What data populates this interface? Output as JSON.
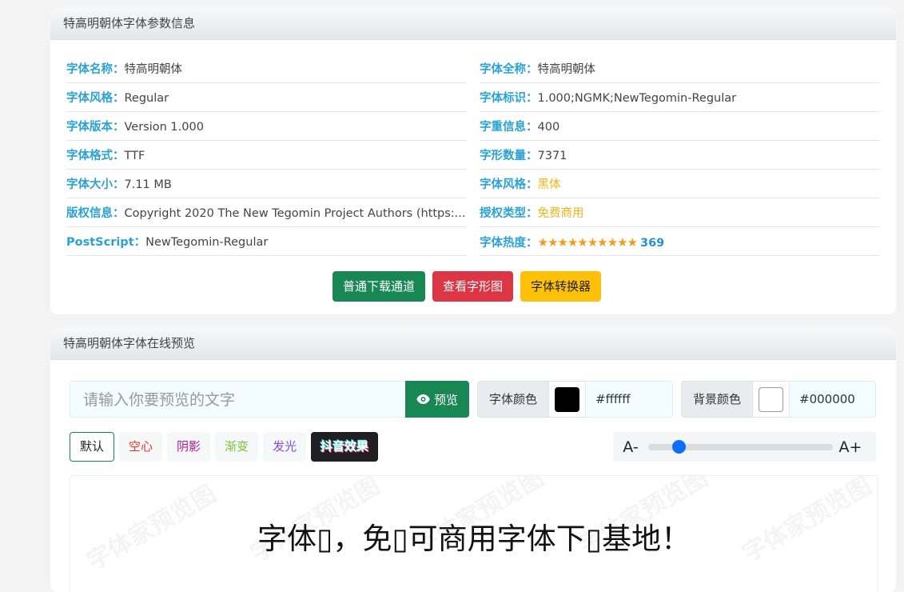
{
  "info_card": {
    "title": "特高明朝体字体参数信息",
    "left": [
      {
        "k": "字体名称：",
        "v": "特高明朝体"
      },
      {
        "k": "字体风格：",
        "v": "Regular"
      },
      {
        "k": "字体版本：",
        "v": "Version 1.000"
      },
      {
        "k": "字体格式：",
        "v": "TTF"
      },
      {
        "k": "字体大小：",
        "v": "7.11 MB"
      },
      {
        "k": "版权信息：",
        "v": "Copyright 2020 The New Tegomin Project Authors (https:..."
      },
      {
        "k": "PostScript：",
        "v": "NewTegomin-Regular"
      }
    ],
    "right": [
      {
        "k": "字体全称：",
        "v": "特高明朝体"
      },
      {
        "k": "字体标识：",
        "v": "1.000;NGMK;NewTegomin-Regular"
      },
      {
        "k": "字重信息：",
        "v": "400"
      },
      {
        "k": "字形数量：",
        "v": "7371"
      },
      {
        "k": "字体风格：",
        "v": "黑体"
      },
      {
        "k": "授权类型：",
        "v": "免费商用"
      }
    ],
    "heat": {
      "k": "字体热度：",
      "stars": "★★★★★★★★★★",
      "value": "369"
    },
    "buttons": {
      "download": "普通下载通道",
      "glyphs": "查看字形图",
      "converter": "字体转换器"
    }
  },
  "preview_card": {
    "title": "特高明朝体字体在线预览",
    "input_placeholder": "请输入你要预览的文字",
    "preview_label": "预览",
    "font_color": {
      "label": "字体颜色",
      "swatch": "#000000",
      "hex": "#ffffff"
    },
    "bg_color": {
      "label": "背景颜色",
      "swatch": "#ffffff",
      "hex": "#000000"
    },
    "effects": {
      "default": "默认",
      "hollow": "空心",
      "shadow": "阴影",
      "gradient": "渐变",
      "glow": "发光",
      "tiktok": "抖音效果"
    },
    "effect_colors": {
      "hollow": "#e0362a",
      "shadow": "#b0199c",
      "gradient": "#7cc23a",
      "glow": "#7b4fe0"
    },
    "size_minus": "A-",
    "size_plus": "A+",
    "size_level": 0.14,
    "sample_text": "字体▯，免▯可商用字体下▯基地！",
    "watermark": "字体家预览图"
  }
}
